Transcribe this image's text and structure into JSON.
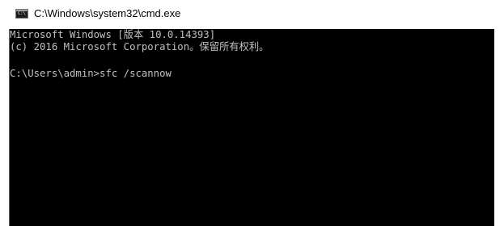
{
  "window": {
    "title": "C:\\Windows\\system32\\cmd.exe",
    "icon": "cmd-console-icon",
    "icon_glyph": "C:\\"
  },
  "console": {
    "lines": [
      "Microsoft Windows [版本 10.0.14393]",
      "(c) 2016 Microsoft Corporation。保留所有权利。",
      "",
      "C:\\Users\\admin>sfc /scannow"
    ],
    "background_color": "#000000",
    "text_color": "#c0c0c0"
  }
}
